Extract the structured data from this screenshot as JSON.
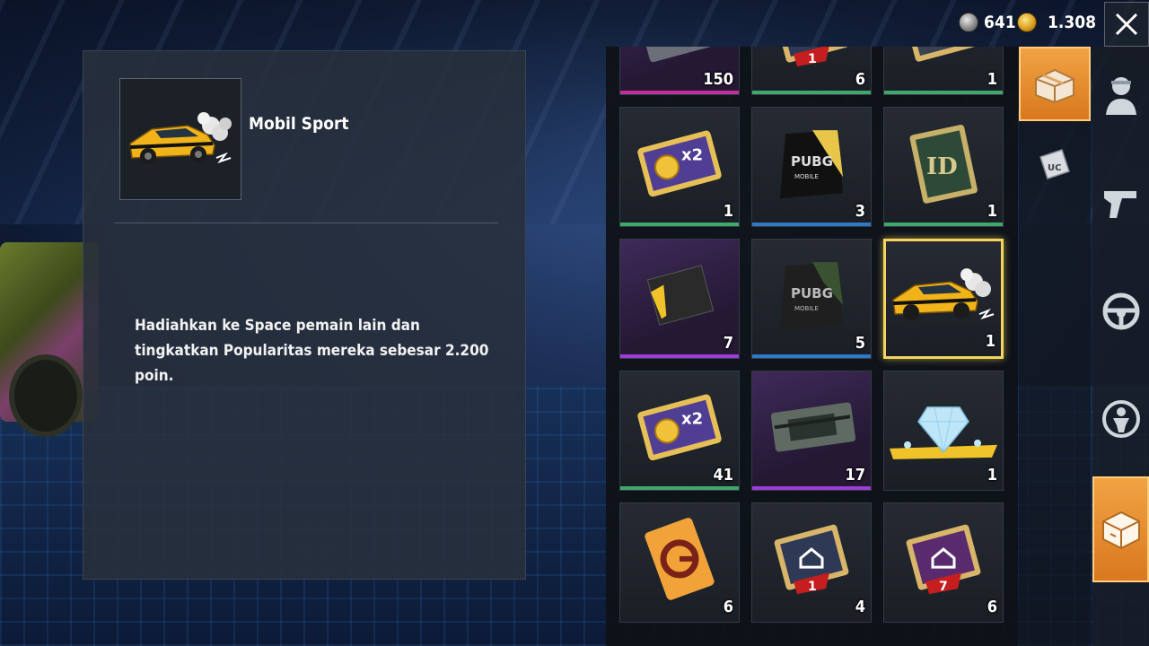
{
  "currency": {
    "silver_amount": "641",
    "gold_amount": "1.308"
  },
  "detail": {
    "item_name": "Mobil Sport",
    "description": "Hadiahkan ke Space pemain lain dan tingkatkan Popularitas mereka sebesar 2.200 poin."
  },
  "inventory": {
    "items": [
      {
        "icon": "ticket-card-icon",
        "count": "150",
        "rarity_color": "#c0309c"
      },
      {
        "icon": "popularity-card-icon",
        "count": "6",
        "rarity_color": "#3fa86b"
      },
      {
        "icon": "rename-card-icon",
        "count": "1",
        "rarity_color": "#3fa86b"
      },
      {
        "icon": "bp-x2-card-icon",
        "count": "1",
        "rarity_color": "#3fa86b"
      },
      {
        "icon": "pubg-gold-banner-icon",
        "count": "3",
        "rarity_color": "#3178c6"
      },
      {
        "icon": "id-card-icon",
        "count": "1",
        "rarity_color": "#3fa86b"
      },
      {
        "icon": "coupon-ticket-icon",
        "count": "7",
        "rarity_color": "#9b3dd6"
      },
      {
        "icon": "pubg-banner-icon",
        "count": "5",
        "rarity_color": "#3178c6"
      },
      {
        "icon": "sport-car-icon",
        "count": "1",
        "rarity_color": "#f4d35e"
      },
      {
        "icon": "bp-x2-card-icon",
        "count": "41",
        "rarity_color": "#3fa86b"
      },
      {
        "icon": "supply-crate-icon",
        "count": "17",
        "rarity_color": "#9b3dd6"
      },
      {
        "icon": "diamond-gift-icon",
        "count": "1",
        "rarity_color": ""
      },
      {
        "icon": "gold-g-ticket-icon",
        "count": "6",
        "rarity_color": ""
      },
      {
        "icon": "popularity-card-icon",
        "count": "4",
        "rarity_color": ""
      },
      {
        "icon": "popularity-card-purple-icon",
        "count": "6",
        "rarity_color": ""
      }
    ]
  },
  "tabs": {
    "sub": [
      {
        "icon": "crate-icon",
        "active": true
      },
      {
        "icon": "uc-icon",
        "active": false
      }
    ],
    "main": [
      {
        "icon": "character-icon"
      },
      {
        "icon": "gun-icon"
      },
      {
        "icon": "steering-wheel-icon"
      },
      {
        "icon": "parachute-icon"
      },
      {
        "icon": "box-icon",
        "active": true
      }
    ]
  }
}
